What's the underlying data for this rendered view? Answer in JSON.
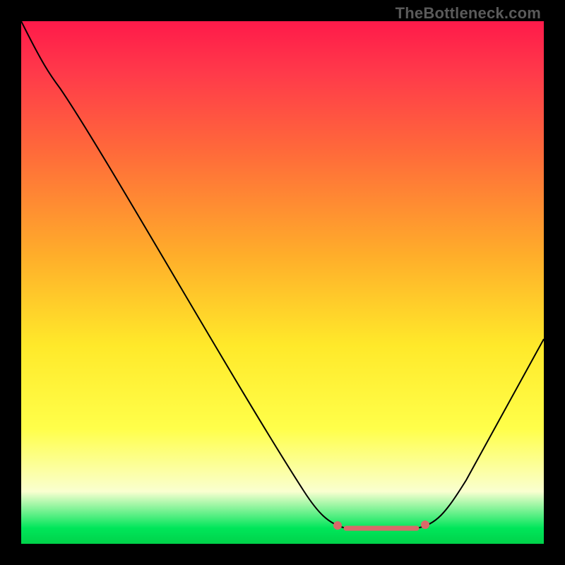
{
  "watermark": "TheBottleneck.com",
  "chart_data": {
    "type": "line",
    "title": "",
    "xlabel": "",
    "ylabel": "",
    "xlim": [
      0,
      100
    ],
    "ylim": [
      0,
      100
    ],
    "background_gradient": {
      "top": "#ff1a4a",
      "mid1": "#ff6a3a",
      "mid2": "#ffe92a",
      "bottom": "#00d24a",
      "meaning": "top = high bottleneck, bottom = low bottleneck"
    },
    "series": [
      {
        "name": "bottleneck-curve",
        "color": "#000000",
        "x": [
          0,
          5,
          10,
          20,
          30,
          40,
          50,
          55,
          60,
          62,
          70,
          76,
          80,
          90,
          100
        ],
        "y": [
          100,
          92,
          87,
          72,
          56,
          40,
          22,
          12,
          5,
          3,
          3,
          3,
          8,
          25,
          40
        ]
      }
    ],
    "optimal_range": {
      "x_start": 62,
      "x_end": 76,
      "y": 3,
      "color": "#d96a6a",
      "note": "flat trough highlighted with thick salmon segment and two end dots"
    },
    "annotations": [
      {
        "text": "TheBottleneck.com",
        "role": "watermark",
        "position": "top-right",
        "color": "#5a5a5a"
      }
    ],
    "axes_visible": false,
    "grid": false
  }
}
